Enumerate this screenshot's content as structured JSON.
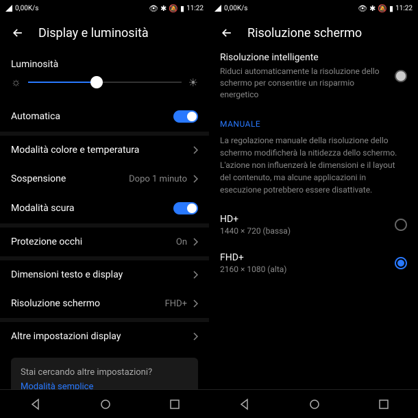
{
  "status": {
    "net_speed": "0,00K/s",
    "time": "11:22"
  },
  "left": {
    "title": "Display e luminosità",
    "brightness_label": "Luminosità",
    "items": {
      "auto": "Automatica",
      "color": "Modalità colore e temperatura",
      "sleep": "Sospensione",
      "sleep_val": "Dopo 1 minuto",
      "dark": "Modalità scura",
      "eye": "Protezione occhi",
      "eye_val": "On",
      "text": "Dimensioni testo e display",
      "res": "Risoluzione schermo",
      "res_val": "FHD+",
      "other": "Altre impostazioni display"
    },
    "hint": {
      "question": "Stai cercando altre impostazioni?",
      "link": "Modalità semplice"
    }
  },
  "right": {
    "title": "Risoluzione schermo",
    "smart": {
      "title": "Risoluzione intelligente",
      "desc": "Riduci automaticamente la risoluzione dello schermo per consentire un risparmio energetico"
    },
    "manual": {
      "header": "MANUALE",
      "desc": "La regolazione manuale della risoluzione dello schermo modificherà la nitidezza dello schermo. L'azione non influenzerà le dimensioni e il layout del contenuto, ma alcune applicazioni in esecuzione potrebbero essere disattivate."
    },
    "options": {
      "hd_title": "HD+",
      "hd_sub": "1440 × 720 (bassa)",
      "fhd_title": "FHD+",
      "fhd_sub": "2160 × 1080 (alta)"
    }
  }
}
